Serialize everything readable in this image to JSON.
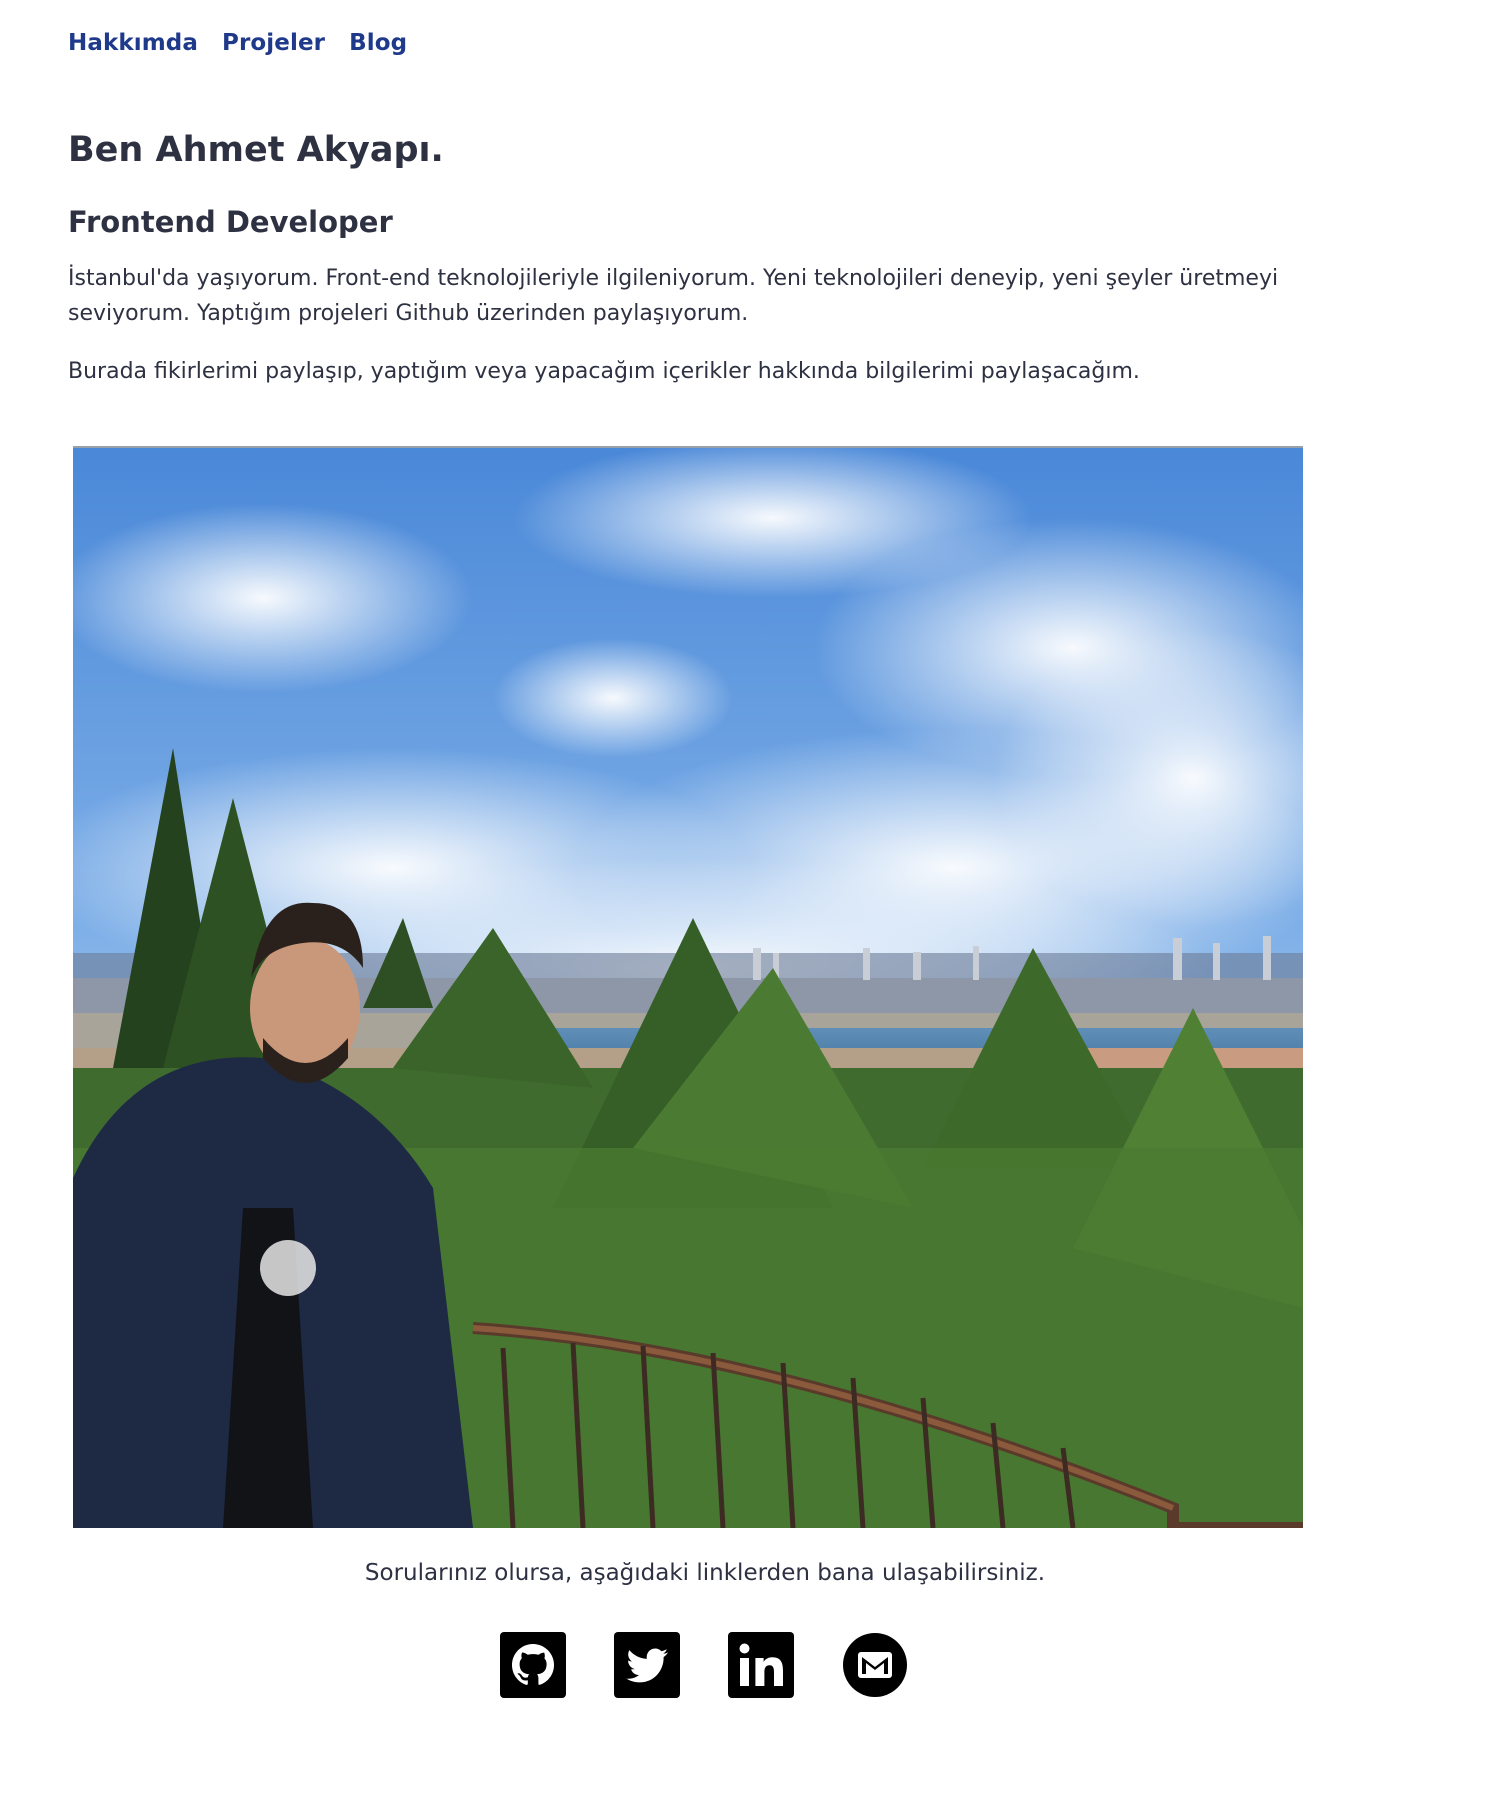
{
  "nav": {
    "items": [
      {
        "label": "Hakkımda"
      },
      {
        "label": "Projeler"
      },
      {
        "label": "Blog"
      }
    ]
  },
  "hero": {
    "title": "Ben Ahmet Akyapı.",
    "subtitle": "Frontend Developer",
    "bio_line1": "İstanbul'da yaşıyorum. Front-end teknolojileriyle ilgileniyorum. Yeni teknolojileri deneyip, yeni şeyler üretmeyi seviyorum. Yaptığım projeleri Github üzerinden paylaşıyorum.",
    "bio_line2": "Burada fikirlerimi paylaşıp, yaptığım veya yapacağım içerikler hakkında bilgilerimi paylaşacağım."
  },
  "contact": {
    "text": "Sorularınız olursa, aşağıdaki linklerden bana ulaşabilirsiniz.",
    "icons": [
      "github-icon",
      "twitter-icon",
      "linkedin-icon",
      "gmail-icon"
    ]
  },
  "colors": {
    "nav_link": "#1f3a8a",
    "text": "#2d3142"
  }
}
